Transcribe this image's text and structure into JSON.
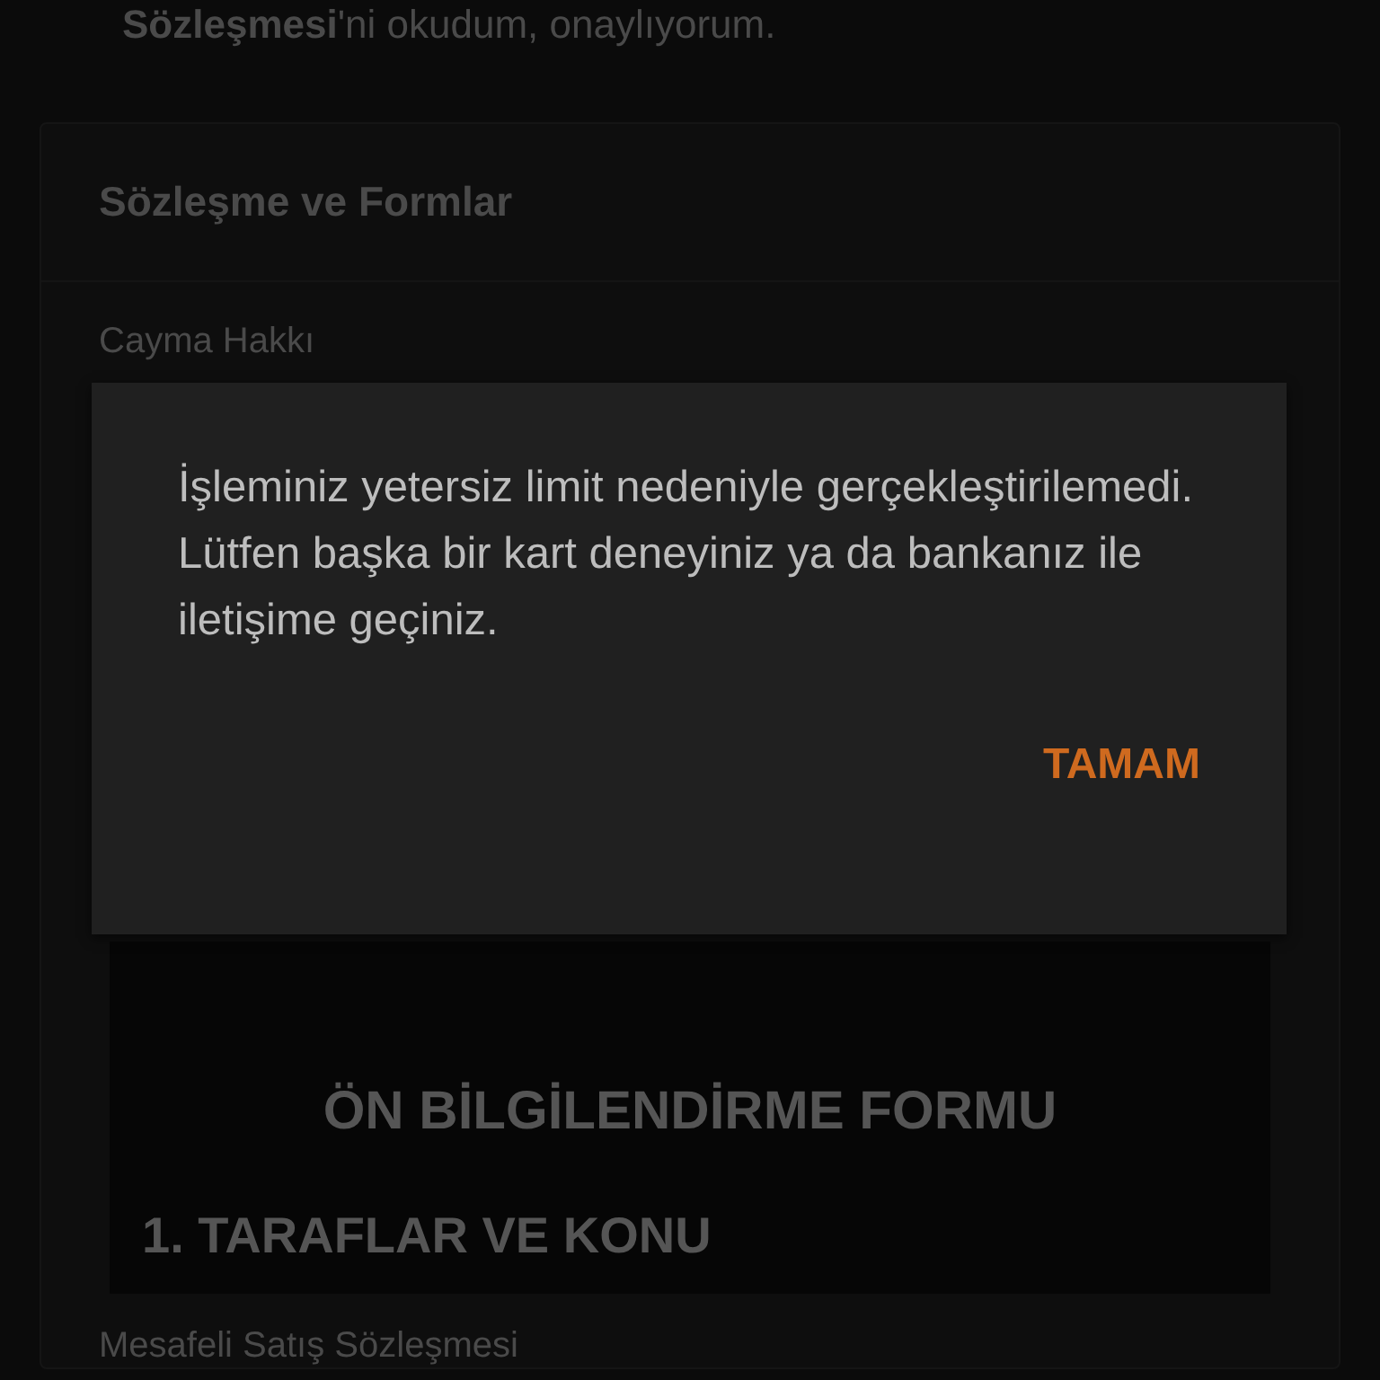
{
  "screen": {
    "consent_text": "**Sözleşmesi**'ni okudum, onaylıyorum.",
    "section_title": "Sözleşme ve Formlar",
    "items": [
      {
        "title": "Cayma Hakkı",
        "document": {
          "title": "ÖN BİLGİLENDİRME FORMU",
          "heading": "1. TARAFLAR VE KONU"
        }
      },
      {
        "title": "Mesafeli Satış Sözleşmesi"
      }
    ]
  },
  "dialog": {
    "message": "İşleminiz yetersiz limit nedeniyle gerçekleştirilemedi. Lütfen başka bir kart deneyiniz ya da bankanız ile iletişime geçiniz.",
    "button": "TAMAM"
  }
}
